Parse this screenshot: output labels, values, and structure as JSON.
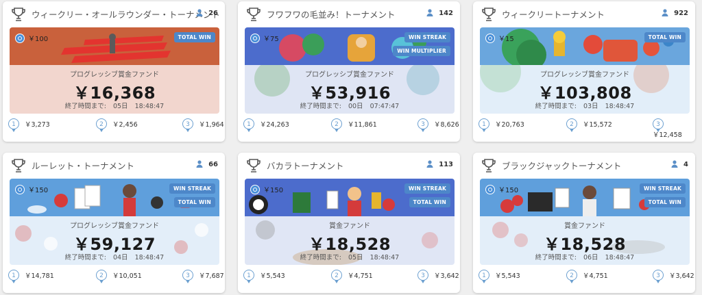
{
  "cards": [
    {
      "title": "ウィークリー・オールラウンダー・トーナメント",
      "players": "26",
      "entry": "￥100",
      "badges": [
        "TOTAL WIN"
      ],
      "fund_label": "プログレッシブ賞金ファンド",
      "amount": "￥16,368",
      "ends_label": "終了時間まで:",
      "ends_days": "05日",
      "ends_time": "18:48:47",
      "prizes": [
        "￥3,273",
        "￥2,456",
        "￥1,964"
      ],
      "theme": {
        "top": "#c9613c",
        "overlay": "#f2d6ce"
      }
    },
    {
      "title": "フワフワの毛並み！トーナメント",
      "players": "142",
      "entry": "￥75",
      "badges": [
        "WIN STREAK",
        "WIN MULTIPLIER"
      ],
      "fund_label": "プログレッシブ賞金ファンド",
      "amount": "￥53,916",
      "ends_label": "終了時間まで:",
      "ends_days": "00日",
      "ends_time": "07:47:47",
      "prizes": [
        "￥24,263",
        "￥11,861",
        "￥8,626"
      ],
      "theme": {
        "top": "#4c6ccc",
        "overlay": "#dfe5f4"
      }
    },
    {
      "title": "ウィークリートーナメント",
      "players": "922",
      "entry": "￥15",
      "badges": [
        "TOTAL WIN"
      ],
      "fund_label": "プログレッシブ賞金ファンド",
      "amount": "￥103,808",
      "ends_label": "終了時間まで:",
      "ends_days": "03日",
      "ends_time": "18:48:47",
      "prizes": [
        "￥20,763",
        "￥15,572",
        "￥12,458"
      ],
      "theme": {
        "top": "#6aa6dd",
        "overlay": "#e2eef9"
      }
    },
    {
      "title": "ルーレット・トーナメント",
      "players": "66",
      "entry": "￥150",
      "badges": [
        "WIN STREAK",
        "TOTAL WIN"
      ],
      "fund_label": "プログレッシブ賞金ファンド",
      "amount": "￥59,127",
      "ends_label": "終了時間まで:",
      "ends_days": "04日",
      "ends_time": "18:48:47",
      "prizes": [
        "￥14,781",
        "￥10,051",
        "￥7,687"
      ],
      "theme": {
        "top": "#5f9fdc",
        "overlay": "#e3eef9"
      }
    },
    {
      "title": "バカラトーナメント",
      "players": "113",
      "entry": "￥150",
      "badges": [
        "WIN STREAK",
        "TOTAL WIN"
      ],
      "fund_label": "賞金ファンド",
      "amount": "￥18,528",
      "ends_label": "終了時間まで:",
      "ends_days": "05日",
      "ends_time": "18:48:47",
      "prizes": [
        "￥5,543",
        "￥4,751",
        "￥3,642"
      ],
      "theme": {
        "top": "#4c6ccc",
        "overlay": "#e0e6f5"
      }
    },
    {
      "title": "ブラックジャックトーナメント",
      "players": "4",
      "entry": "￥150",
      "badges": [
        "WIN STREAK",
        "TOTAL WIN"
      ],
      "fund_label": "賞金ファンド",
      "amount": "￥18,528",
      "ends_label": "終了時間まで:",
      "ends_days": "06日",
      "ends_time": "18:48:47",
      "prizes": [
        "￥5,543",
        "￥4,751",
        "￥3,642"
      ],
      "theme": {
        "top": "#5f9fdc",
        "overlay": "#e3eef9"
      }
    }
  ],
  "colors": {
    "accent": "#4d87c9",
    "medal": "#6b9fd0",
    "background": "#efefef"
  },
  "icons": {
    "title": "trophy-icon",
    "players": "person-icon",
    "entry": "coin-icon",
    "prize": "medal-icon"
  }
}
